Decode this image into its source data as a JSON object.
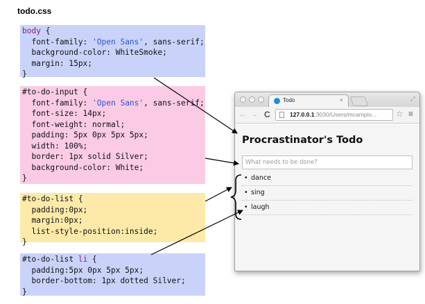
{
  "file_title": "todo.css",
  "code": {
    "body_block": [
      [
        {
          "t": "body",
          "c": "kw"
        },
        {
          "t": " {"
        }
      ],
      [
        {
          "t": "  font-family: "
        },
        {
          "t": "'Open Sans'",
          "c": "str"
        },
        {
          "t": ", sans-serif;"
        }
      ],
      [
        {
          "t": "  background-color: WhiteSmoke;"
        }
      ],
      [
        {
          "t": "  margin: 15px;"
        }
      ],
      [
        {
          "t": "}"
        }
      ]
    ],
    "input_block": [
      [
        {
          "t": "#to-do-input {"
        }
      ],
      [
        {
          "t": "  font-family: "
        },
        {
          "t": "'Open Sans'",
          "c": "str"
        },
        {
          "t": ", sans-serif;"
        }
      ],
      [
        {
          "t": "  font-size: 14px;"
        }
      ],
      [
        {
          "t": "  font-weight: normal;"
        }
      ],
      [
        {
          "t": "  padding: 5px 0px 5px 5px;"
        }
      ],
      [
        {
          "t": "  width: 100%;"
        }
      ],
      [
        {
          "t": "  border: 1px solid Silver;"
        }
      ],
      [
        {
          "t": "  background-color: White;"
        }
      ],
      [
        {
          "t": "}"
        }
      ]
    ],
    "list_block": [
      [
        {
          "t": "#to-do-list {"
        }
      ],
      [
        {
          "t": "  padding:0px;"
        }
      ],
      [
        {
          "t": "  margin:0px;"
        }
      ],
      [
        {
          "t": "  list-style-position:inside;"
        }
      ],
      [
        {
          "t": "}"
        }
      ]
    ],
    "li_block": [
      [
        {
          "t": "#to-do-list "
        },
        {
          "t": "li",
          "c": "kw"
        },
        {
          "t": " {"
        }
      ],
      [
        {
          "t": "  padding:5px 0px 5px 5px;"
        }
      ],
      [
        {
          "t": "  border-bottom: 1px dotted Silver;"
        }
      ],
      [
        {
          "t": "}"
        }
      ]
    ]
  },
  "browser": {
    "tab_title": "Todo",
    "tab_close": "×",
    "url_host": "127.0.0.1",
    "url_rest": ":3030/Users/mcampio...",
    "back_glyph": "←",
    "forward_glyph": "→",
    "reload_glyph": "C",
    "star_glyph": "☆",
    "menu_glyph": "≡",
    "resize_glyph": "⤢"
  },
  "app": {
    "title": "Procrastinator's Todo",
    "input_placeholder": "What needs to be done?",
    "bullet": "•",
    "items": [
      "dance",
      "sing",
      "laugh"
    ]
  },
  "colors": {
    "body_block_bg": "#c9d3fa",
    "input_block_bg": "#fbcbe5",
    "list_block_bg": "#fdeaa9",
    "li_block_bg": "#c9d3fa",
    "keyword": "#8a1a8a",
    "string": "#2b55d6"
  }
}
